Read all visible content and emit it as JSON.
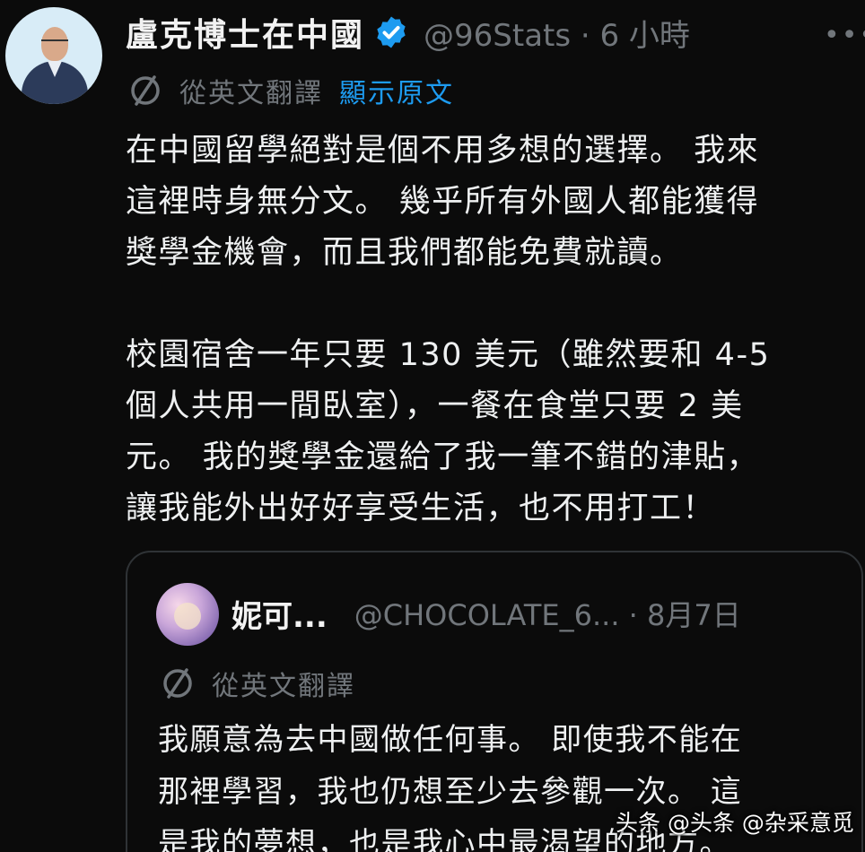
{
  "tweet": {
    "display_name": "盧克博士在中國",
    "handle_time": "@96Stats · 6 小時",
    "more_icon": "more-horizontal-icon",
    "translated_from": "從英文翻譯",
    "show_original": "顯示原文",
    "paragraph1": [
      "在中國留學絕對是個不用多想的選擇。 我來",
      "這裡時身無分文。 幾乎所有外國人都能獲得",
      "獎學金機會，而且我們都能免費就讀。"
    ],
    "paragraph2": [
      "校園宿舍一年只要 130 美元（雖然要和 4-5",
      "個人共用一間臥室），一餐在食堂只要 2 美",
      "元。 我的獎學金還給了我一筆不錯的津貼，",
      "讓我能外出好好享受生活，也不用打工！"
    ]
  },
  "quote": {
    "display_name": "妮可...",
    "handle_date": "@CHOCOLATE_6...  · 8月7日",
    "translated_from": "從英文翻譯",
    "text": [
      "我願意為去中國做任何事。 即使我不能在",
      "那裡學習，我也仍想至少去參觀一次。 這",
      "是我的夢想，也是我心中最渴望的地方。"
    ]
  },
  "watermark": "头条 @头条 @杂采意觅",
  "colors": {
    "background": "#0b0b0b",
    "text": "#eef0f1",
    "muted": "#71767b",
    "link": "#1d9bf0",
    "verified": "#1d9bf0",
    "border": "#2f3336"
  }
}
